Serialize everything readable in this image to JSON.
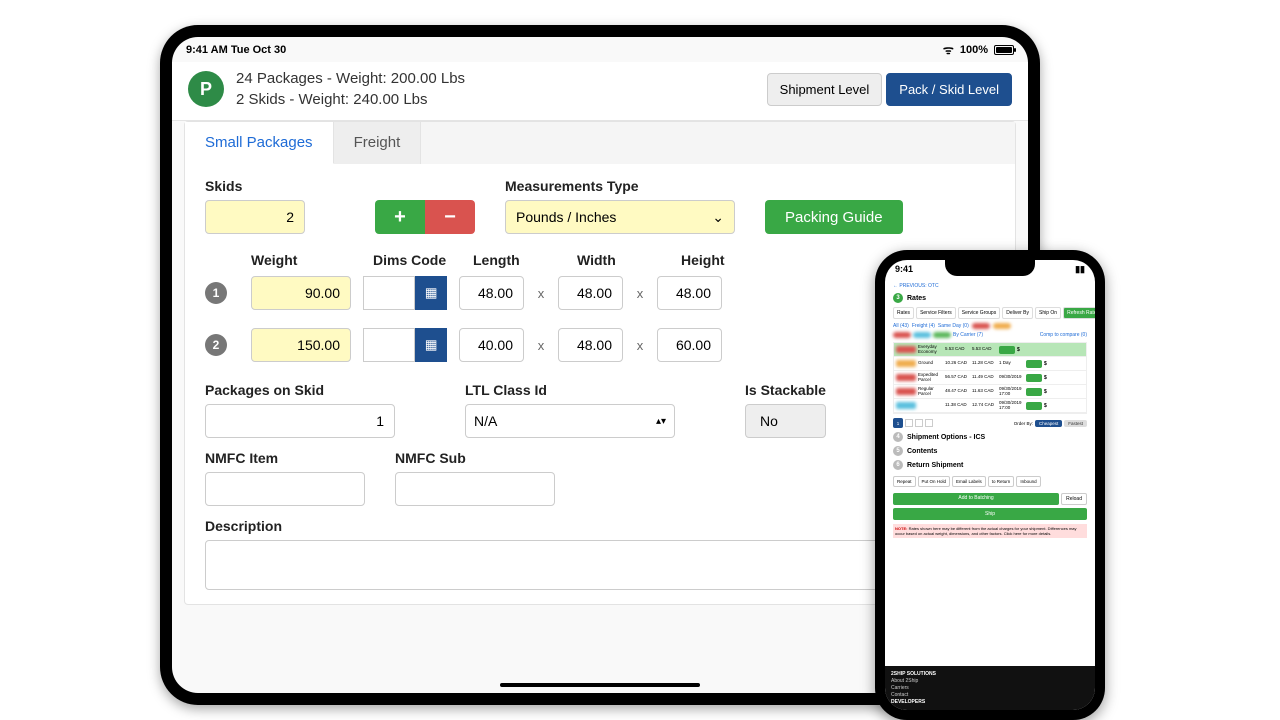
{
  "ipad": {
    "status": {
      "time_date": "9:41 AM  Tue Oct 30",
      "battery": "100%"
    },
    "avatar_letter": "P",
    "summary_line1": "24 Packages - Weight: 200.00 Lbs",
    "summary_line2": "2 Skids - Weight: 240.00 Lbs",
    "level_buttons": {
      "shipment": "Shipment Level",
      "pack": "Pack / Skid Level"
    },
    "tabs": {
      "small": "Small Packages",
      "freight": "Freight"
    },
    "skids_label": "Skids",
    "skids_value": "2",
    "measurements_label": "Measurements Type",
    "measurements_value": "Pounds / Inches",
    "packing_guide": "Packing Guide",
    "columns": {
      "weight": "Weight",
      "dims": "Dims Code",
      "length": "Length",
      "width": "Width",
      "height": "Height"
    },
    "skid_rows": [
      {
        "idx": "1",
        "weight": "90.00",
        "length": "48.00",
        "width": "48.00",
        "height": "48.00"
      },
      {
        "idx": "2",
        "weight": "150.00",
        "length": "40.00",
        "width": "48.00",
        "height": "60.00"
      }
    ],
    "bottom": {
      "packages_on_skid_label": "Packages on Skid",
      "packages_on_skid_value": "1",
      "ltl_class_label": "LTL Class Id",
      "ltl_class_value": "N/A",
      "stackable_label": "Is Stackable",
      "stackable_value": "No",
      "nmfc_item_label": "NMFC Item",
      "nmfc_sub_label": "NMFC Sub",
      "description_label": "Description"
    }
  },
  "iphone": {
    "time": "9:41",
    "rates_label": "Rates",
    "tabs": [
      "Rates",
      "Service Filters",
      "Service Groups",
      "Deliver By",
      "Ship On"
    ],
    "refresh": "Refresh Rates",
    "filter_tags": [
      "All (43)",
      "Freight (4)",
      "Same Day (0)"
    ],
    "carrier_label": "By Carrier (7)",
    "compare": "Comp to compare (0)",
    "rate_rows": [
      {
        "svc": "Everyday Economy",
        "p1": "5.53 CAD",
        "p2": "5.53 CAD",
        "selected": true
      },
      {
        "svc": "Ground",
        "p1": "10.26 CAD",
        "p2": "11.28 CAD",
        "d": "1 Day"
      },
      {
        "svc": "Expedited Parcel",
        "p1": "56.57 CAD",
        "p2": "11.49 CAD",
        "d": "09/30/2019"
      },
      {
        "svc": "Regular Parcel",
        "p1": "48.47 CAD",
        "p2": "11.63 CAD",
        "d": "09/30/2019 17:00"
      },
      {
        "svc": "",
        "p1": "11.38 CAD",
        "p2": "12.74 CAD",
        "d": "09/30/2019 17:00"
      }
    ],
    "order_by": "Order By:",
    "cheapest": "Cheapest",
    "fastest": "Fastest",
    "steps": [
      "Shipment Options - ICS",
      "Contents",
      "Return Shipment"
    ],
    "action_btns": [
      "Repeat",
      "Put On Hold",
      "Email Labels",
      "to Return",
      "Inbound"
    ],
    "add_to_batching": "Add to Batching",
    "reload": "Reload",
    "ship": "Ship",
    "note": "Rates shown here may be different from the actual charges for your shipment. Differences may occur based on actual weight, dimensions, and other factors. Click here for more details.",
    "note_prefix": "NOTE:",
    "footer_heading": "2SHIP SOLUTIONS",
    "footer_links": [
      "About 2Ship",
      "Carriers",
      "Contact"
    ],
    "footer_dev": "DEVELOPERS"
  }
}
